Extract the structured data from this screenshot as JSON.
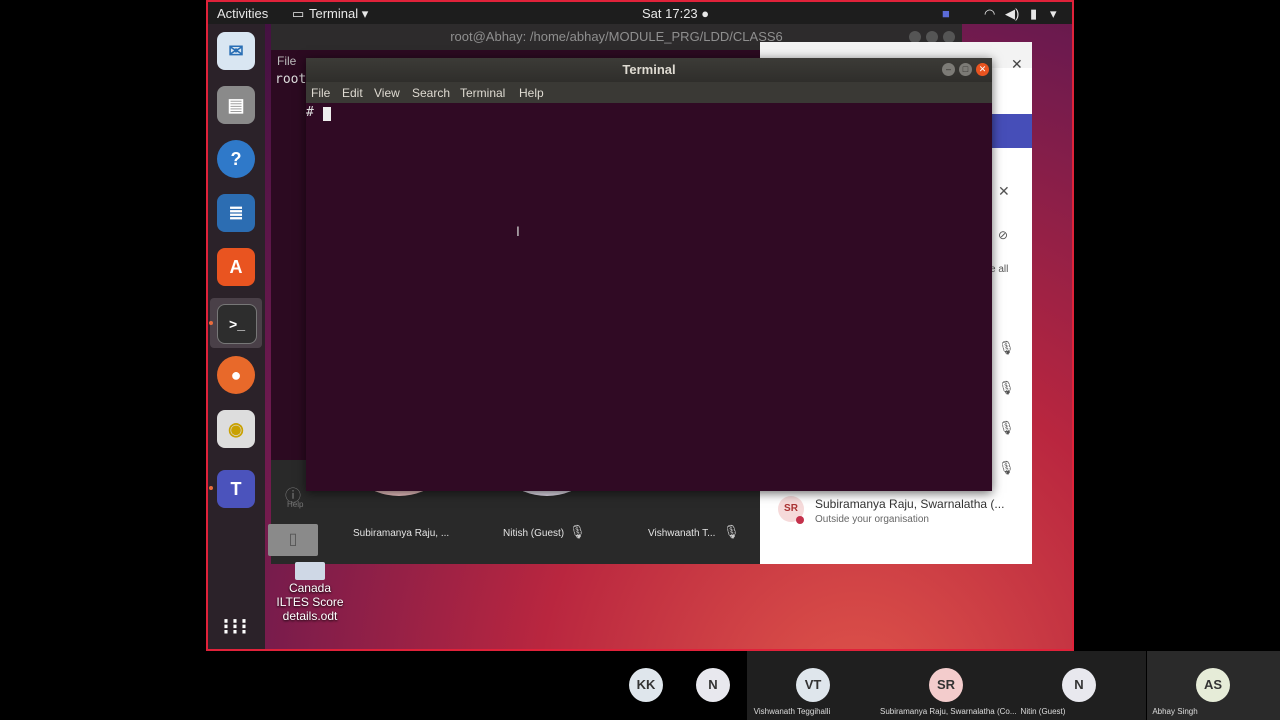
{
  "topbar": {
    "activities": "Activities",
    "app_menu": "Terminal ▾",
    "clock": "Sat 17:23 ●"
  },
  "bg_terminal": {
    "title": "root@Abhay: /home/abhay/MODULE_PRG/LDD/CLASS6",
    "menu_file": "File",
    "first_line": "root"
  },
  "terminal": {
    "title": "Terminal",
    "menu": [
      "File",
      "Edit",
      "View",
      "Search",
      "Terminal",
      "Help"
    ],
    "prompt": "#"
  },
  "teams_panel": {
    "partial_text": "e all",
    "participant_initials": "SR",
    "participant_name": "Subiramanya Raju, Swarnalatha (...",
    "participant_sub": "Outside your organisation"
  },
  "tiles": [
    {
      "name": "Subiramanya Raju, ..."
    },
    {
      "name": "Nitish (Guest)"
    },
    {
      "name": "Vishwanath T..."
    }
  ],
  "help_label": "Help",
  "desktop_file": {
    "line1": "Canada",
    "line2": "ILTES Score",
    "line3": "details.odt"
  },
  "bottom_participants": [
    {
      "initials": "KK",
      "name": ""
    },
    {
      "initials": "N",
      "name": ""
    },
    {
      "initials": "VT",
      "name": "Vishwanath Teggihalli"
    },
    {
      "initials": "SR",
      "name": "Subiramanya Raju, Swarnalatha (Co..."
    },
    {
      "initials": "N",
      "name": "Nitin (Guest)"
    },
    {
      "initials": "AS",
      "name": "Abhay Singh"
    }
  ],
  "colors": {
    "terminal_bg": "#300a24",
    "accent_red": "#e0223a",
    "close_btn": "#e95420"
  }
}
